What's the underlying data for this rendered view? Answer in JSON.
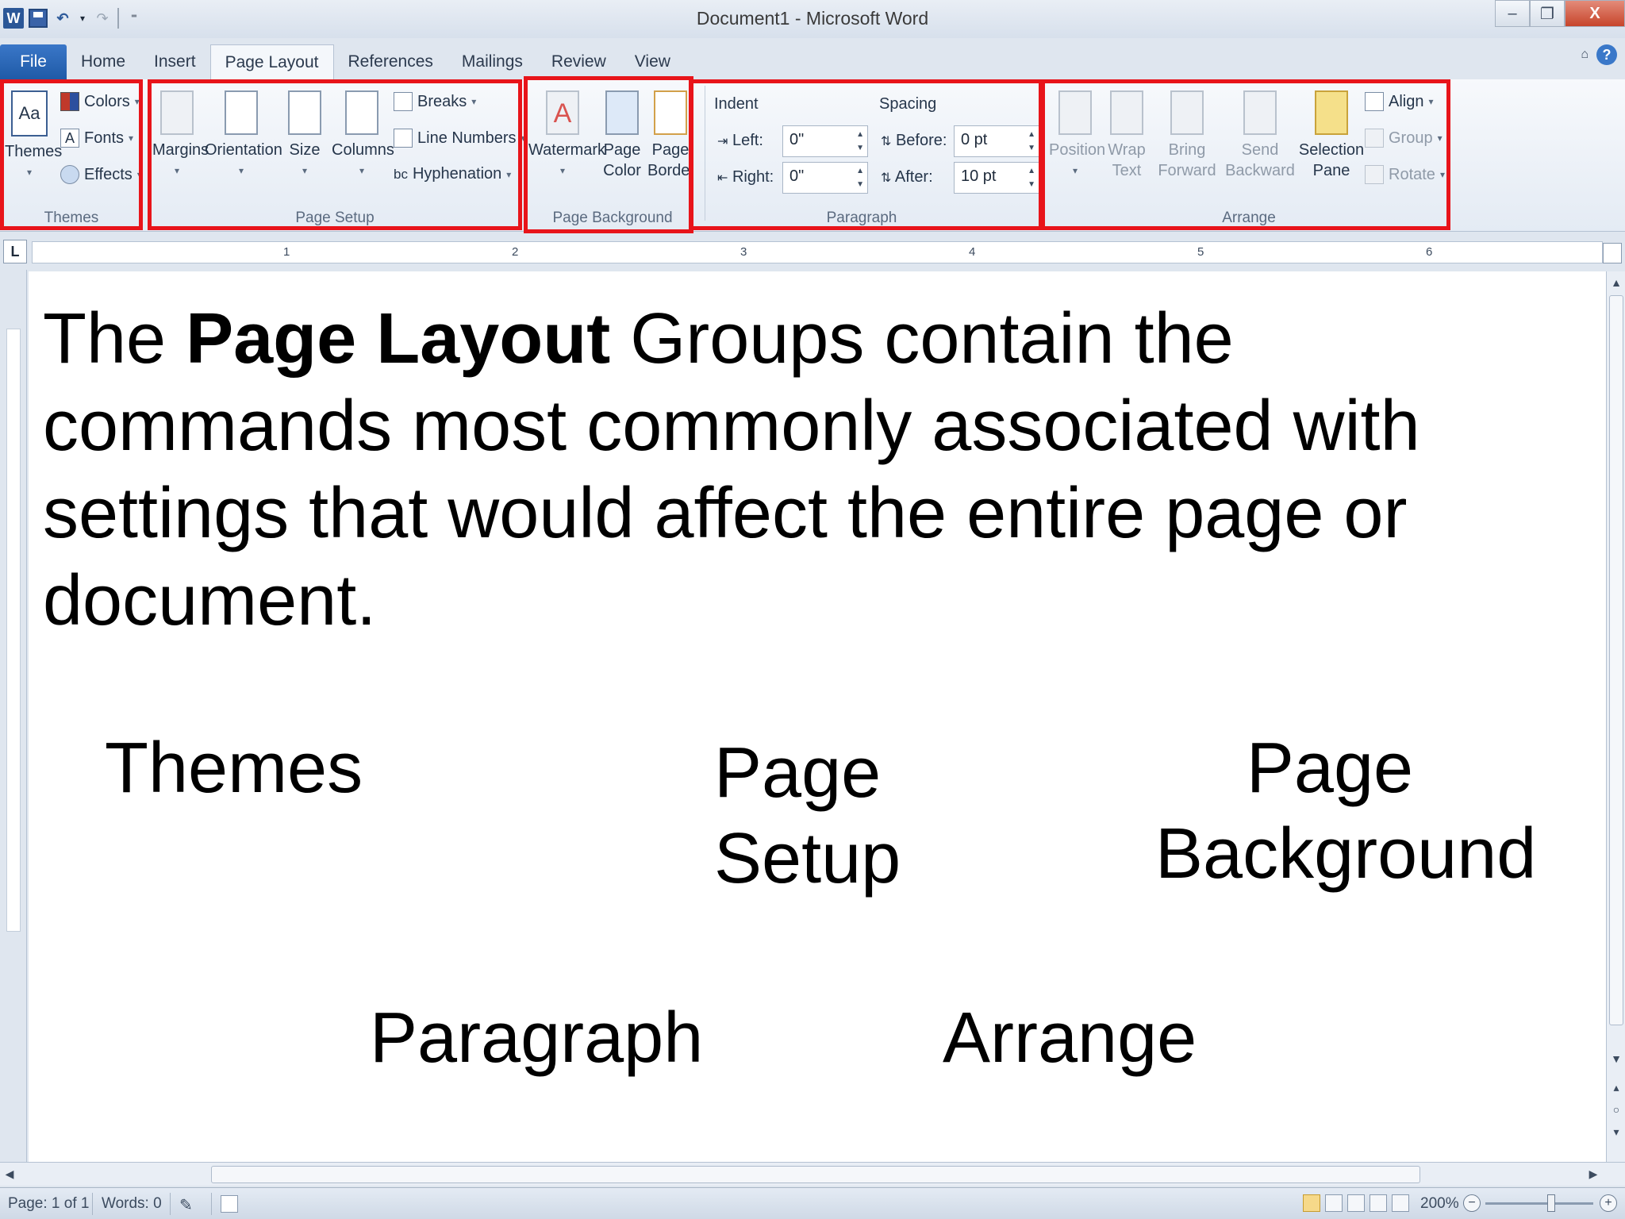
{
  "window": {
    "title": "Document1  -  Microsoft Word",
    "minimize": "–",
    "restore": "❐",
    "close": "X"
  },
  "qat": {
    "app_icon": "W",
    "undo": "↶",
    "undo_drop": "▾",
    "redo": "↷",
    "customize": "⁼"
  },
  "tabs": [
    {
      "label": "File"
    },
    {
      "label": "Home"
    },
    {
      "label": "Insert"
    },
    {
      "label": "Page Layout",
      "active": true
    },
    {
      "label": "References"
    },
    {
      "label": "Mailings"
    },
    {
      "label": "Review"
    },
    {
      "label": "View"
    }
  ],
  "tabs_right": {
    "minimize_ribbon": "⌂",
    "help": "?"
  },
  "ribbon": {
    "themes": {
      "label": "Themes",
      "themes_btn": "Themes",
      "themes_glyph": "Aa",
      "colors": "Colors",
      "fonts": "Fonts",
      "fonts_glyph": "A",
      "effects": "Effects"
    },
    "page_setup": {
      "label": "Page Setup",
      "margins": "Margins",
      "orientation": "Orientation",
      "size": "Size",
      "columns": "Columns",
      "breaks": "Breaks",
      "line_numbers": "Line Numbers",
      "hyphenation": "Hyphenation",
      "hyphenation_glyph": "bc"
    },
    "page_background": {
      "label": "Page Background",
      "watermark": "Watermark",
      "page_color_1": "Page",
      "page_color_2": "Color",
      "page_borders_1": "Page",
      "page_borders_2": "Borders"
    },
    "paragraph": {
      "label": "Paragraph",
      "indent": "Indent",
      "spacing": "Spacing",
      "left_label": "Left:",
      "left_value": "0\"",
      "right_label": "Right:",
      "right_value": "0\"",
      "before_label": "Before:",
      "before_value": "0 pt",
      "after_label": "After:",
      "after_value": "10 pt"
    },
    "arrange": {
      "label": "Arrange",
      "position": "Position",
      "wrap_1": "Wrap",
      "wrap_2": "Text",
      "bring_1": "Bring",
      "bring_2": "Forward",
      "send_1": "Send",
      "send_2": "Backward",
      "selection_1": "Selection",
      "selection_2": "Pane",
      "align": "Align",
      "group": "Group",
      "rotate": "Rotate"
    }
  },
  "ruler": {
    "tab_selector": "L",
    "numbers": [
      "1",
      "2",
      "3",
      "4",
      "5",
      "6"
    ]
  },
  "document": {
    "para_pre": "The ",
    "para_bold": "Page Layout",
    "para_post": " Groups contain the commands most commonly associated with settings that would affect the entire page or document.",
    "word_themes": "Themes",
    "word_page_setup_1": "Page",
    "word_page_setup_2": "Setup",
    "word_page_bg_1": "Page",
    "word_page_bg_2": "Background",
    "word_paragraph": "Paragraph",
    "word_arrange": "Arrange"
  },
  "status": {
    "page": "Page: 1 of 1",
    "words": "Words: 0",
    "zoom": "200%",
    "zoom_minus": "−",
    "zoom_plus": "+"
  },
  "colors": {
    "highlight_box": "#e8141a",
    "file_tab": "#2a66b5"
  }
}
